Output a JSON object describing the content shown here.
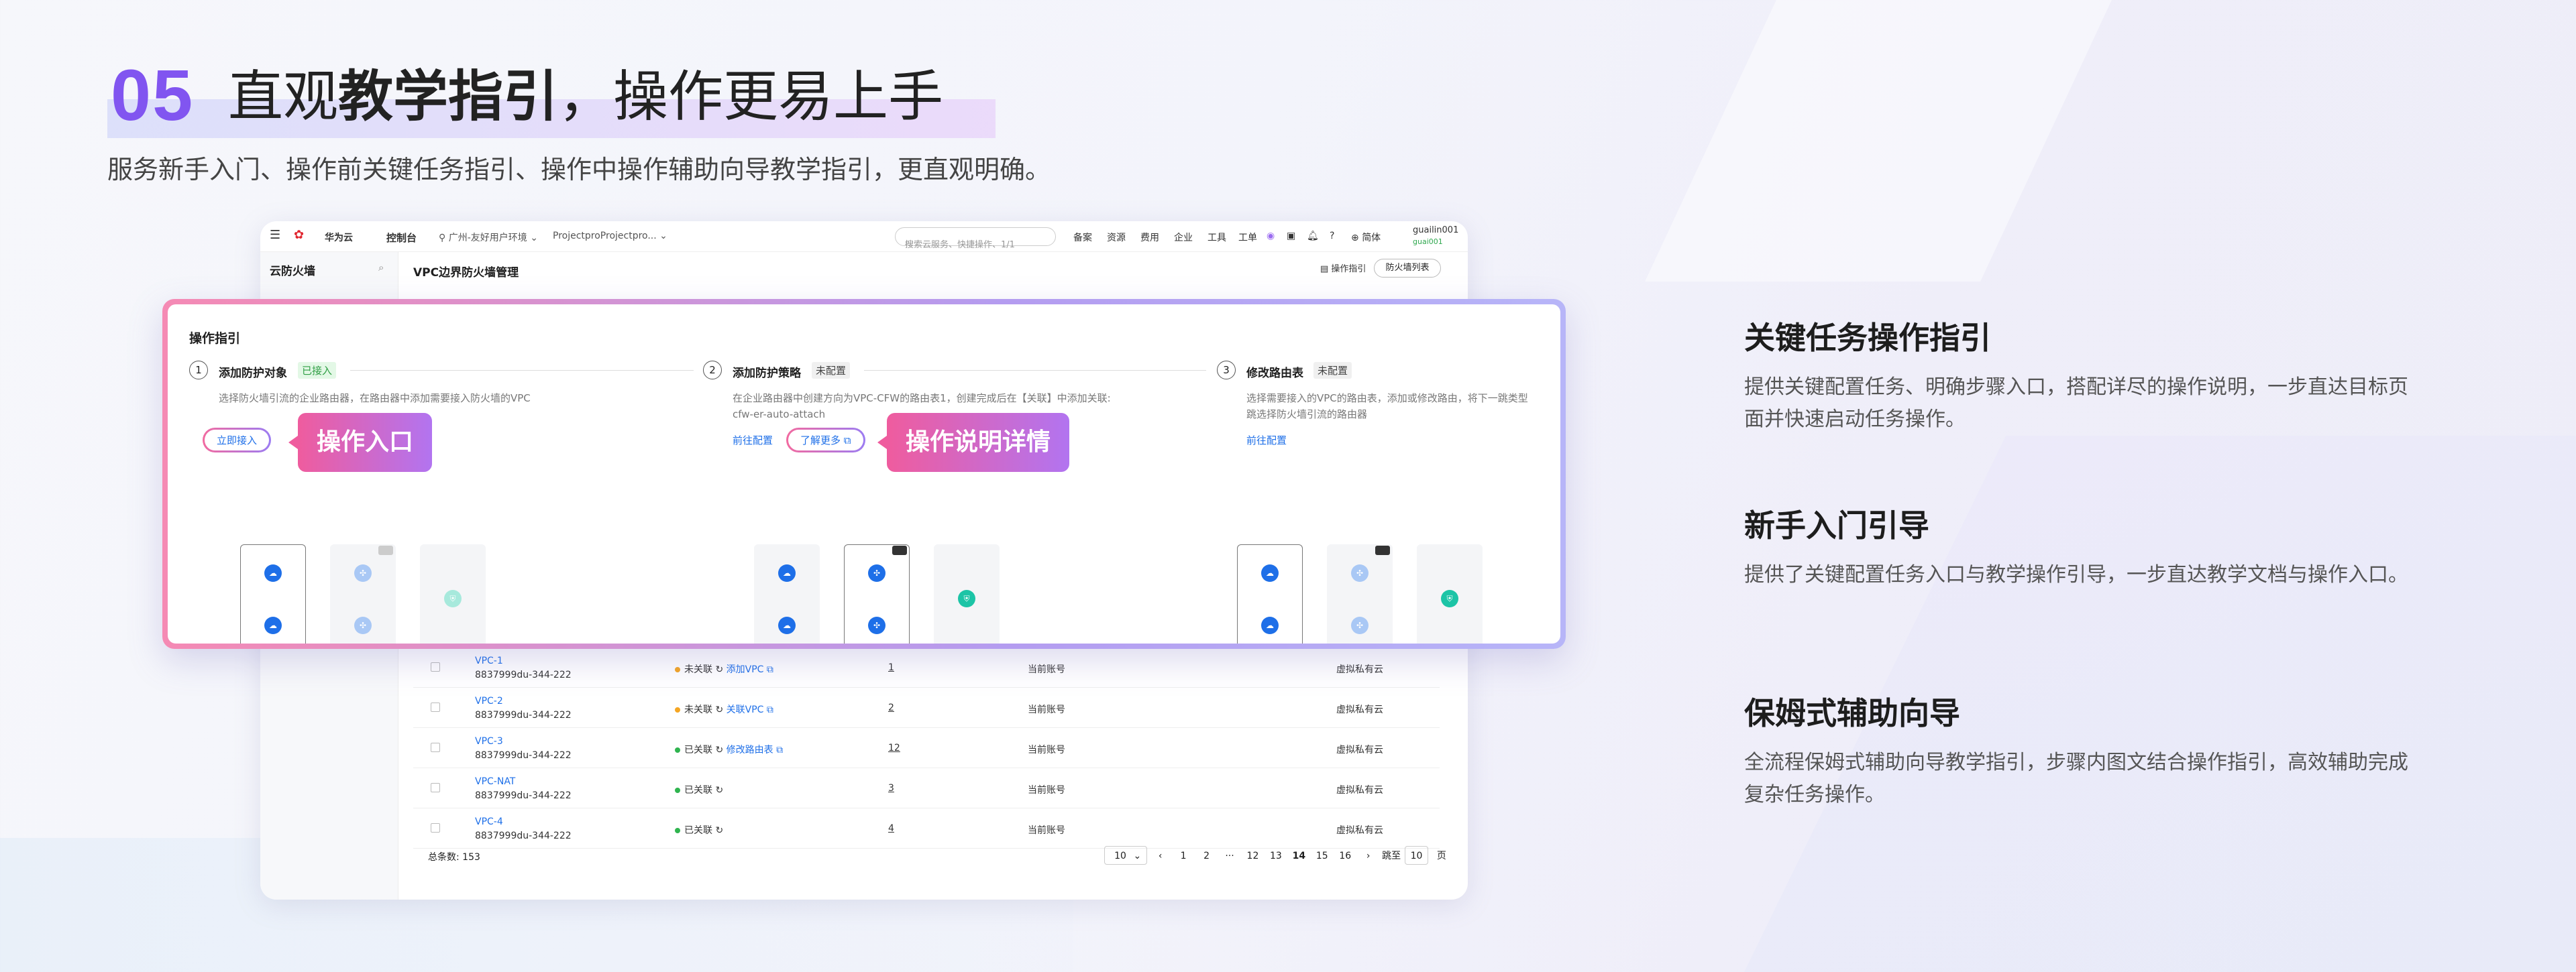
{
  "header": {
    "number": "05",
    "title_part1": "直观",
    "title_bold": "教学指引",
    "title_part2": "，操作更易上手",
    "subtitle": "服务新手入门、操作前关键任务指引、操作中操作辅助向导教学指引，更直观明确。"
  },
  "console": {
    "brand": "华为云",
    "control": "控制台",
    "region": "广州-友好用户环境",
    "project": "ProjectproProjectpro...",
    "search_placeholder": "搜索云服务、快捷操作、1/1",
    "nav": [
      "备案",
      "资源",
      "费用",
      "企业",
      "工具",
      "工单"
    ],
    "lang": "简体",
    "user": "guailin001",
    "user_sub": "guai001",
    "sidebar_title": "云防火墙",
    "page_title": "VPC边界防火墙管理",
    "op_guide": "操作指引",
    "fw_list": "防火墙列表",
    "rows": [
      {
        "name": "VPC-1",
        "id": "8837999du-344-222",
        "status": "未关联",
        "action": "添加VPC",
        "count": "1",
        "account": "当前账号",
        "type": "虚拟私有云",
        "color": "#f5a623"
      },
      {
        "name": "VPC-2",
        "id": "8837999du-344-222",
        "status": "未关联",
        "action": "关联VPC",
        "count": "2",
        "account": "当前账号",
        "type": "虚拟私有云",
        "color": "#f5a623"
      },
      {
        "name": "VPC-3",
        "id": "8837999du-344-222",
        "status": "已关联",
        "action": "修改路由表",
        "count": "12",
        "account": "当前账号",
        "type": "虚拟私有云",
        "color": "#2fb44f"
      },
      {
        "name": "VPC-NAT",
        "id": "8837999du-344-222",
        "status": "已关联",
        "action": "",
        "count": "3",
        "account": "当前账号",
        "type": "虚拟私有云",
        "color": "#2fb44f"
      },
      {
        "name": "VPC-4",
        "id": "8837999du-344-222",
        "status": "已关联",
        "action": "",
        "count": "4",
        "account": "当前账号",
        "type": "虚拟私有云",
        "color": "#2fb44f"
      }
    ],
    "total_label": "总条数: 153",
    "page_size": "10",
    "pages": [
      "1",
      "2",
      "···",
      "12",
      "13",
      "14",
      "15",
      "16"
    ],
    "jump_label": "跳至",
    "jump_value": "10",
    "page_unit": "页"
  },
  "guide": {
    "title": "操作指引",
    "steps": [
      {
        "num": "1",
        "name": "添加防护对象",
        "tag": "已接入",
        "desc": "选择防火墙引流的企业路由器，在路由器中添加需要接入防火墙的VPC",
        "desc2": "",
        "link": "立即接入"
      },
      {
        "num": "2",
        "name": "添加防护策略",
        "tag": "未配置",
        "desc": "在企业路由器中创建方向为VPC-CFW的路由表1，创建完成后在【关联】中添加关联:",
        "desc2": "cfw-er-auto-attach",
        "link": "前往配置",
        "link2": "了解更多"
      },
      {
        "num": "3",
        "name": "修改路由表",
        "tag": "未配置",
        "desc": "选择需要接入的VPC的路由表，添加或修改路由，将下一跳类型",
        "desc2": "跳选择防火墙引流的路由器",
        "link": "前往配置"
      }
    ],
    "callout1": "操作入口",
    "callout2": "操作说明详情"
  },
  "features": [
    {
      "title": "关键任务操作指引",
      "desc": "提供关键配置任务、明确步骤入口，搭配详尽的操作说明，一步直达目标页面并快速启动任务操作。"
    },
    {
      "title": "新手入门引导",
      "desc": "提供了关键配置任务入口与教学操作引导，一步直达教学文档与操作入口。"
    },
    {
      "title": "保姆式辅助向导",
      "desc": "全流程保姆式辅助向导教学指引，步骤内图文结合操作指引，高效辅助完成复杂任务操作。"
    }
  ],
  "colors": {
    "accent": "#8155f0",
    "link": "#1e6fe8",
    "gradient_start": "#ef5c9e",
    "gradient_end": "#b274f0"
  }
}
